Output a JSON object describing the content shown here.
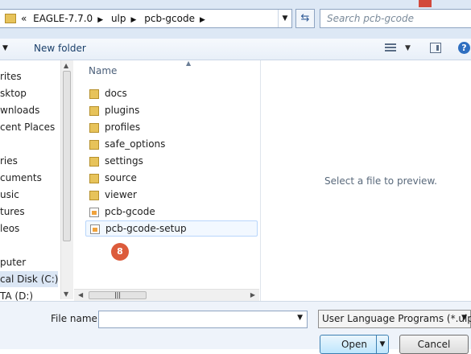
{
  "address": {
    "crumbs": [
      "«",
      "EAGLE-7.7.0",
      "ulp",
      "pcb-gcode"
    ],
    "search_placeholder": "Search pcb-gcode"
  },
  "toolbar": {
    "new_folder": "New folder"
  },
  "nav": {
    "items": [
      "rites",
      "sktop",
      "wnloads",
      "cent Places",
      "ries",
      "cuments",
      "usic",
      "tures",
      "leos",
      "puter",
      "cal Disk (C:)",
      "TA (D:)"
    ]
  },
  "files": {
    "column_name": "Name",
    "items": [
      {
        "name": "docs",
        "type": "folder"
      },
      {
        "name": "plugins",
        "type": "folder"
      },
      {
        "name": "profiles",
        "type": "folder"
      },
      {
        "name": "safe_options",
        "type": "folder"
      },
      {
        "name": "settings",
        "type": "folder"
      },
      {
        "name": "source",
        "type": "folder"
      },
      {
        "name": "viewer",
        "type": "folder"
      },
      {
        "name": "pcb-gcode",
        "type": "file"
      },
      {
        "name": "pcb-gcode-setup",
        "type": "file"
      }
    ],
    "badge": "8"
  },
  "preview": {
    "text": "Select a file to preview."
  },
  "bottom": {
    "file_name_label": "File name:",
    "file_name_value": "",
    "file_type": "User Language Programs (*.ulp",
    "open": "Open",
    "cancel": "Cancel"
  }
}
